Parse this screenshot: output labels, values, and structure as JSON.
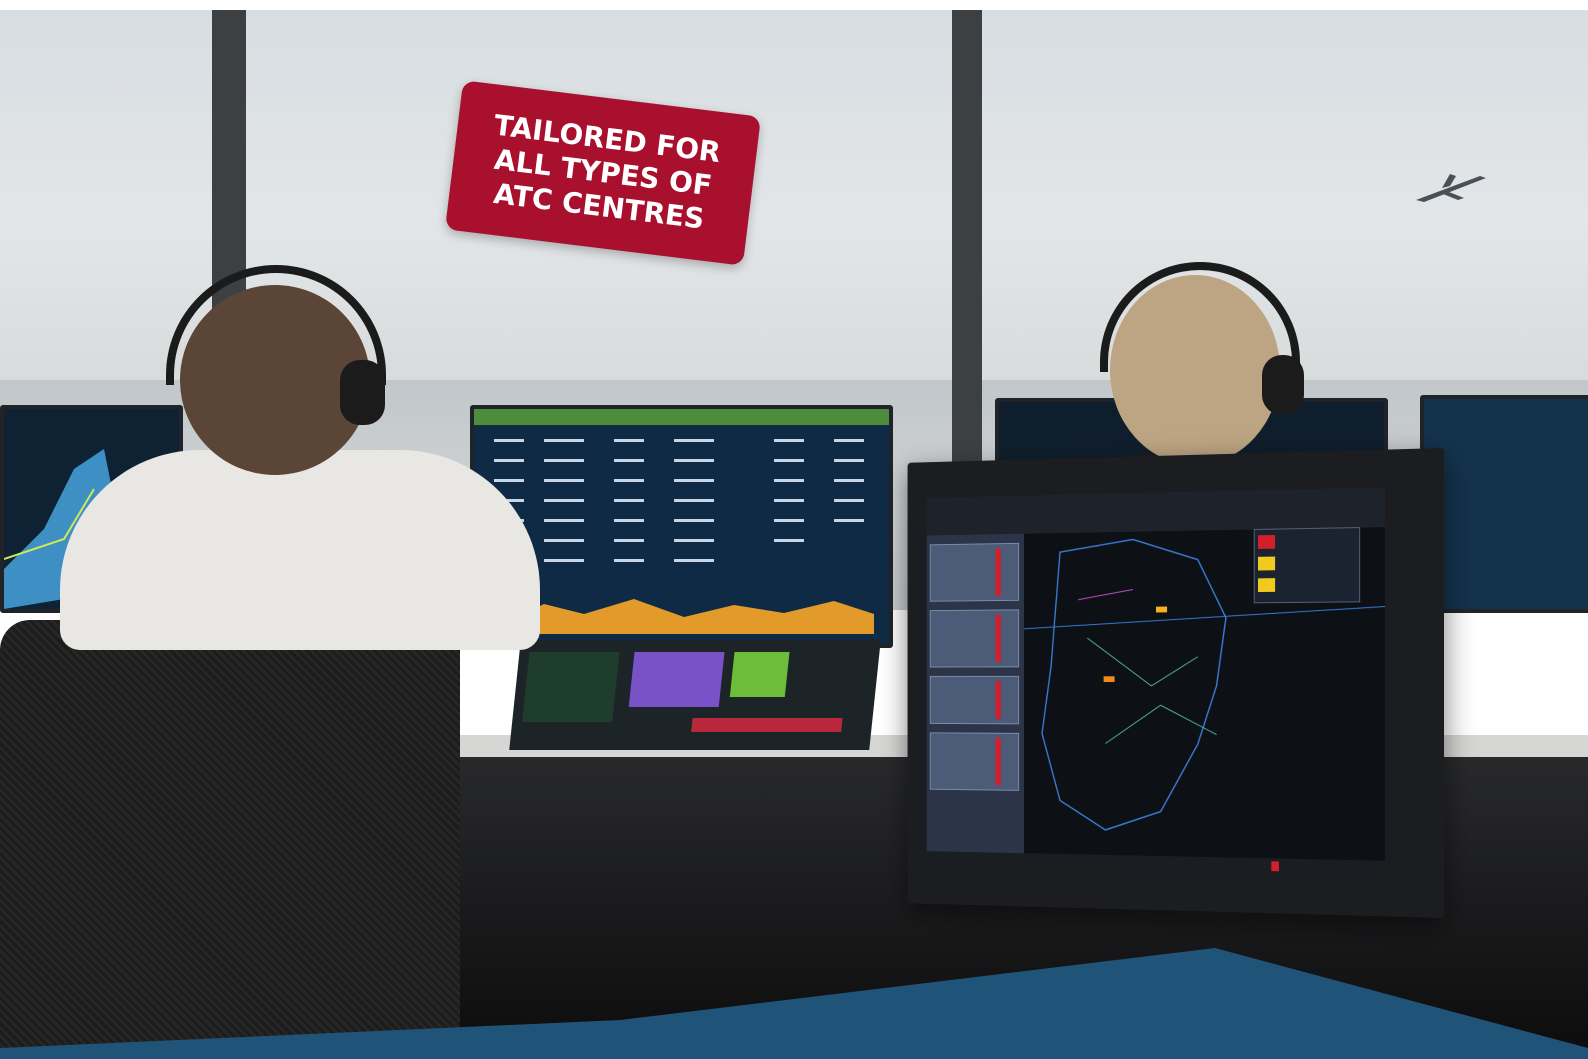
{
  "badge": {
    "text": "TAILORED FOR ALL TYPES OF ATC CENTRES"
  },
  "colors": {
    "badge": "#a8102e",
    "band": "#1f5377",
    "sky": "#dfe3e5"
  }
}
